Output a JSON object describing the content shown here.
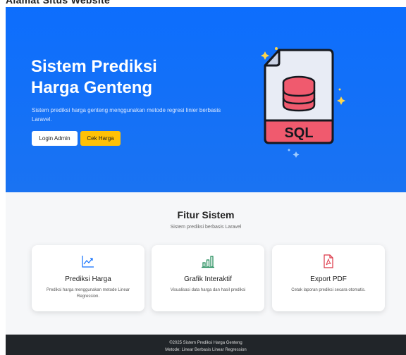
{
  "top_strip": {
    "text": "Alamat Situs Website"
  },
  "hero": {
    "title_line1": "Sistem Prediksi",
    "title_line2": "Harga Genteng",
    "description": "Sistem prediksi harga genteng menggunakan metode regresi linier berbasis Laravel.",
    "login_label": "Login Admin",
    "cek_label": "Cek Harga",
    "illustration_label": "SQL"
  },
  "features": {
    "title": "Fitur Sistem",
    "subtitle": "Sistem prediksi berbasis Laravel",
    "cards": [
      {
        "icon": "trend-chart-icon",
        "title": "Prediksi Harga",
        "desc": "Prediksi harga menggunakan metode Linear Regression."
      },
      {
        "icon": "bar-chart-icon",
        "title": "Grafik Interaktif",
        "desc": "Visualisasi data harga dan hasil prediksi"
      },
      {
        "icon": "pdf-file-icon",
        "title": "Export PDF",
        "desc": "Cetak laporan prediksi secara otomatis."
      }
    ]
  },
  "footer": {
    "line1": "©2025 Sistem Prediksi Harga Genteng",
    "line2": "Metode: Linear Berbasis Linear Regression"
  },
  "colors": {
    "primary": "#0d6efd",
    "warning": "#ffc107",
    "sql_red": "#f05a6e",
    "footer": "#212529"
  }
}
